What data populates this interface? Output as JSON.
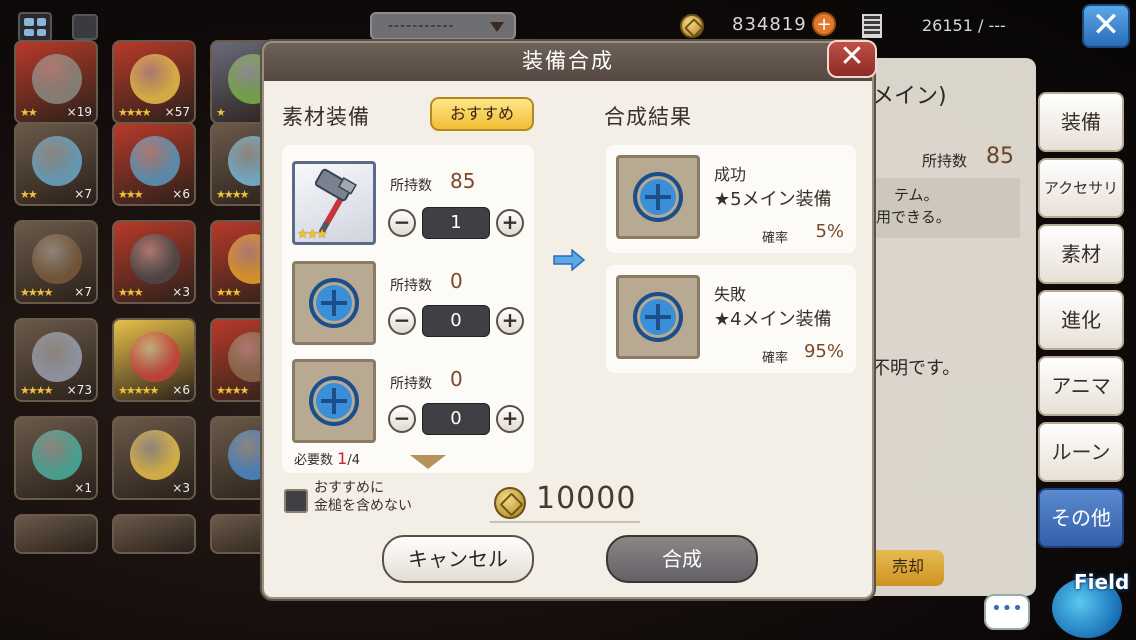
{
  "topbar": {
    "sort_label": "-----------",
    "money": "834819",
    "plus": "+",
    "stamina": "26151 / ---",
    "close_glyph": "✕"
  },
  "inventory": [
    {
      "stars": "★★",
      "count": "×19",
      "color": "#b83a2a",
      "art": "#8a8a80"
    },
    {
      "stars": "★★★★",
      "count": "×57",
      "color": "#b83a2a",
      "art": "#e8c04a"
    },
    {
      "stars": "★",
      "count": "",
      "color": "#6a6a7a",
      "art": "#7ab04a"
    },
    {
      "stars": "★★",
      "count": "×7",
      "color": "#6a5a4a",
      "art": "#6aa8c8"
    },
    {
      "stars": "★★★",
      "count": "×6",
      "color": "#b83a2a",
      "art": "#5a9ac0"
    },
    {
      "stars": "★★★★",
      "count": "",
      "color": "#6a5a4a",
      "art": "#7ab8d8"
    },
    {
      "stars": "★★★★",
      "count": "×7",
      "color": "#6a5a4a",
      "art": "#7a5a3a"
    },
    {
      "stars": "★★★",
      "count": "×3",
      "color": "#b83a2a",
      "art": "#4a4a4a"
    },
    {
      "stars": "★★★",
      "count": "",
      "color": "#b83a2a",
      "art": "#e8a22a"
    },
    {
      "stars": "★★★★",
      "count": "×73",
      "color": "#6a5a4a",
      "art": "#9aa0b0"
    },
    {
      "stars": "★★★★★",
      "count": "×6",
      "color": "#e8c04a",
      "art": "#c8403a"
    },
    {
      "stars": "★★★★",
      "count": "",
      "color": "#b83a2a",
      "art": "#8a6a4a"
    },
    {
      "stars": "",
      "count": "×1",
      "color": "#6a5a4a",
      "art": "#4ab0a0"
    },
    {
      "stars": "",
      "count": "×3",
      "color": "#6a5a4a",
      "art": "#e8c04a"
    },
    {
      "stars": "",
      "count": "",
      "color": "#6a5a4a",
      "art": "#4a8ad0"
    }
  ],
  "right_panel": {
    "title": "メイン)",
    "count_label": "所持数",
    "count": "85",
    "desc_line1": "テム。",
    "desc_line2": "用できる。",
    "note": "不明です。",
    "sell_label": "売却"
  },
  "side_tabs": [
    {
      "label": "装備",
      "active": false
    },
    {
      "label": "アクセサリ",
      "active": false
    },
    {
      "label": "素材",
      "active": false
    },
    {
      "label": "進化",
      "active": false
    },
    {
      "label": "アニマ",
      "active": false
    },
    {
      "label": "ルーン",
      "active": false
    },
    {
      "label": "その他",
      "active": true
    }
  ],
  "chat_glyph": "•••",
  "field_label": "Field",
  "modal": {
    "title": "装備合成",
    "close_glyph": "✕",
    "materials_title": "素材装備",
    "recommend_label": "おすすめ",
    "result_title": "合成結果",
    "materials": [
      {
        "own_label": "所持数",
        "own": "85",
        "qty": "1",
        "filled": true,
        "stars": "★★★"
      },
      {
        "own_label": "所持数",
        "own": "0",
        "qty": "0",
        "filled": false,
        "stars": ""
      },
      {
        "own_label": "所持数",
        "own": "0",
        "qty": "0",
        "filled": false,
        "stars": ""
      }
    ],
    "minus": "−",
    "plus": "+",
    "need_label": "必要数",
    "need_current": "1",
    "need_total": "/4",
    "checkbox_label_line1": "おすすめに",
    "checkbox_label_line2": "金槌を含めない",
    "cost": "10000",
    "results": [
      {
        "status": "成功",
        "name": "★5メイン装備",
        "rate_label": "確率",
        "rate": "5%"
      },
      {
        "status": "失敗",
        "name": "★4メイン装備",
        "rate_label": "確率",
        "rate": "95%"
      }
    ],
    "cancel_label": "キャンセル",
    "synthesize_label": "合成"
  },
  "colors": {
    "accent_gold": "#f2bd34",
    "header_brown": "#544840",
    "close_red": "#8e2a24",
    "plus_blue": "#3a8fd8",
    "active_tab": "#335fa8"
  }
}
